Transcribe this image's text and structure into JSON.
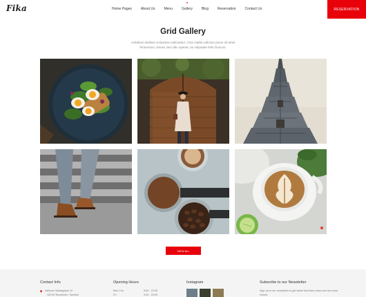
{
  "header": {
    "logo": "Fika",
    "nav": [
      {
        "label": "Home Pages",
        "active": false
      },
      {
        "label": "About Us",
        "active": false
      },
      {
        "label": "Menu",
        "active": false
      },
      {
        "label": "Gallery",
        "active": true
      },
      {
        "label": "Blog",
        "active": false
      },
      {
        "label": "Reservation",
        "active": false
      },
      {
        "label": "Contact Us",
        "active": false
      }
    ],
    "reservation_button": "RESERVATION"
  },
  "gallery": {
    "title": "Grid Gallery",
    "subtitle": "Ambitioni dedisse scripsisse iudicaretur. Cras mattis iudicium purus sit amet fermentum. Donec sed odio operae, eu vulputate felis rhoncus.",
    "images": [
      {
        "icon": "salad-plate-image"
      },
      {
        "icon": "woman-at-door-image"
      },
      {
        "icon": "temple-tower-image"
      },
      {
        "icon": "shoes-on-stairs-image"
      },
      {
        "icon": "coffee-grounds-image"
      },
      {
        "icon": "latte-art-image"
      }
    ],
    "view_all": "VIEW ALL"
  },
  "footer": {
    "contact": {
      "heading": "Contact Info",
      "lines": [
        "Valhmer Vaultagatan 12",
        "123 50 Stockholm, Sweden"
      ]
    },
    "hours": {
      "heading": "Opening Hours",
      "rows": [
        {
          "day": "Mon-Thu",
          "time": "9:00 - 22:00"
        },
        {
          "day": "Fri",
          "time": "9:00 - 23:00"
        }
      ]
    },
    "instagram": {
      "heading": "Instagram"
    },
    "newsletter": {
      "heading": "Subscribe to our Newsletter",
      "text": "Sign up to our newsletter to get latest food item news and our news events."
    }
  },
  "colors": {
    "accent": "#e8000b"
  }
}
